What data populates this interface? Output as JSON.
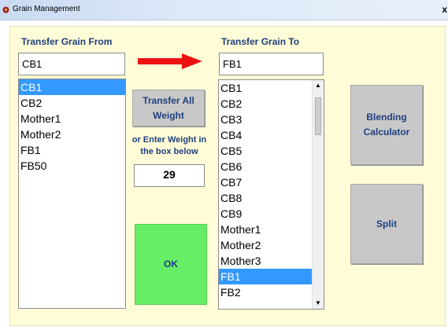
{
  "window": {
    "title": "Grain Management",
    "close_glyph": "x",
    "icon": "app-icon"
  },
  "from": {
    "label": "Transfer Grain From",
    "value": "CB1",
    "items": [
      "CB1",
      "CB2",
      "Mother1",
      "Mother2",
      "FB1",
      "FB50"
    ],
    "selected": "CB1"
  },
  "to": {
    "label": "Transfer Grain To",
    "value": "FB1",
    "items": [
      "CB1",
      "CB2",
      "CB3",
      "CB4",
      "CB5",
      "CB6",
      "CB7",
      "CB8",
      "CB9",
      "Mother1",
      "Mother2",
      "Mother3",
      "FB1",
      "FB2"
    ],
    "selected": "FB1"
  },
  "middle": {
    "transfer_all_line1": "Transfer All",
    "transfer_all_line2": "Weight",
    "hint_line1": "or Enter Weight in",
    "hint_line2": "the box below",
    "weight": "29",
    "ok_label": "OK"
  },
  "right": {
    "blending_line1": "Blending",
    "blending_line2": "Calculator",
    "split_label": "Split"
  },
  "colors": {
    "form_bg": "#fffcd7",
    "label": "#1f3f7f",
    "selected_bg": "#3399ff",
    "ok_bg": "#66ee66",
    "arrow": "#ee1111",
    "button_bg": "#c8c8c8"
  }
}
